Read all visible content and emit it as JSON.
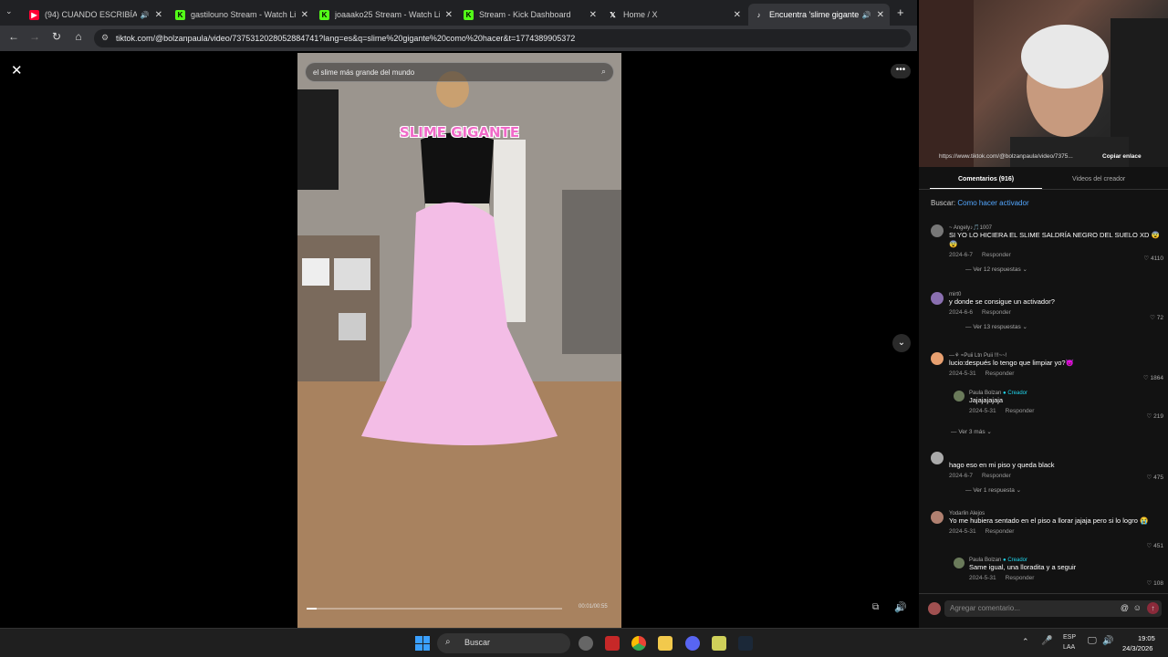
{
  "tabs": [
    {
      "label": "(94) CUANDO ESCRIBÍA ASÍ",
      "color": "#ff0033",
      "glyph": "▶"
    },
    {
      "label": "gastilouno Stream - Watch Live",
      "color": "#53fc18",
      "glyph": "K"
    },
    {
      "label": "joaaako25 Stream - Watch Live",
      "color": "#53fc18",
      "glyph": "K"
    },
    {
      "label": "Stream - Kick Dashboard",
      "color": "#53fc18",
      "glyph": "K"
    },
    {
      "label": "Home / X",
      "color": "#ffffff",
      "glyph": "X"
    },
    {
      "label": "Encuentra 'slime gigante c",
      "color": "#ffffff",
      "glyph": "♪"
    }
  ],
  "address": {
    "url": "tiktok.com/@bolzanpaula/video/7375312028052884741?lang=es&q=slime%20gigante%20como%20hacer&t=1774389905372"
  },
  "video": {
    "search_text": "el slime más grande del mundo",
    "overlay_title": "SLIME GIGANTE",
    "timecode": "00:01/00:55",
    "progress": 0.04
  },
  "panel": {
    "link": "https://www.tiktok.com/@bolzanpaula/video/7375...",
    "copy_link": "Copiar enlace",
    "tab_comments": "Comentarios (916)",
    "tab_videos": "Videos del creador",
    "search_prefix": "Buscar:",
    "search_suggestion": "Como hacer activador",
    "comment_placeholder": "Agregar comentario...",
    "reply_label": "Responder",
    "creator_label": "Creador"
  },
  "comments": [
    {
      "name": "~ Angely♪🎵1007",
      "text": "SI YO LO HICIERA EL SLIME SALDRÍA NEGRO DEL SUELO XD 😨😨",
      "date": "2024-6-7",
      "likes": "4110",
      "replies": "Ver 12 respuestas"
    },
    {
      "name": "mirt0",
      "text": "y donde se consigue un activador?",
      "date": "2024-6-6",
      "likes": "72",
      "replies": "Ver 13 respuestas"
    },
    {
      "name": "—⚘ ≈Puii Ltn Puii !!!~~!",
      "text": "lucio:después lo tengo que limpiar yo?😈",
      "date": "2024-5-31",
      "likes": "1864",
      "replies": "Ver 3 más"
    },
    {
      "name": "",
      "text": "hago eso en mi piso y queda black",
      "date": "2024-6-7",
      "likes": "475",
      "replies": "Ver 1 respuesta"
    },
    {
      "name": "Yodarlin Alejos",
      "text": "Yo me hubiera sentado en el piso a llorar jajaja pero si lo logro 😭",
      "date": "2024-5-31",
      "likes": "451",
      "replies": ""
    }
  ],
  "creator_replies": [
    {
      "name": "Paula Bolzan",
      "text": "Jajajajajaja",
      "date": "2024-5-31",
      "likes": "219"
    },
    {
      "name": "Paula Bolzan",
      "text": "Same igual, una lloradita y a seguir",
      "date": "2024-5-31",
      "likes": "108"
    }
  ],
  "taskbar": {
    "search": "Buscar",
    "lang1": "ESP",
    "lang2": "LAA",
    "time": "19:05",
    "date": "24/3/2026"
  }
}
